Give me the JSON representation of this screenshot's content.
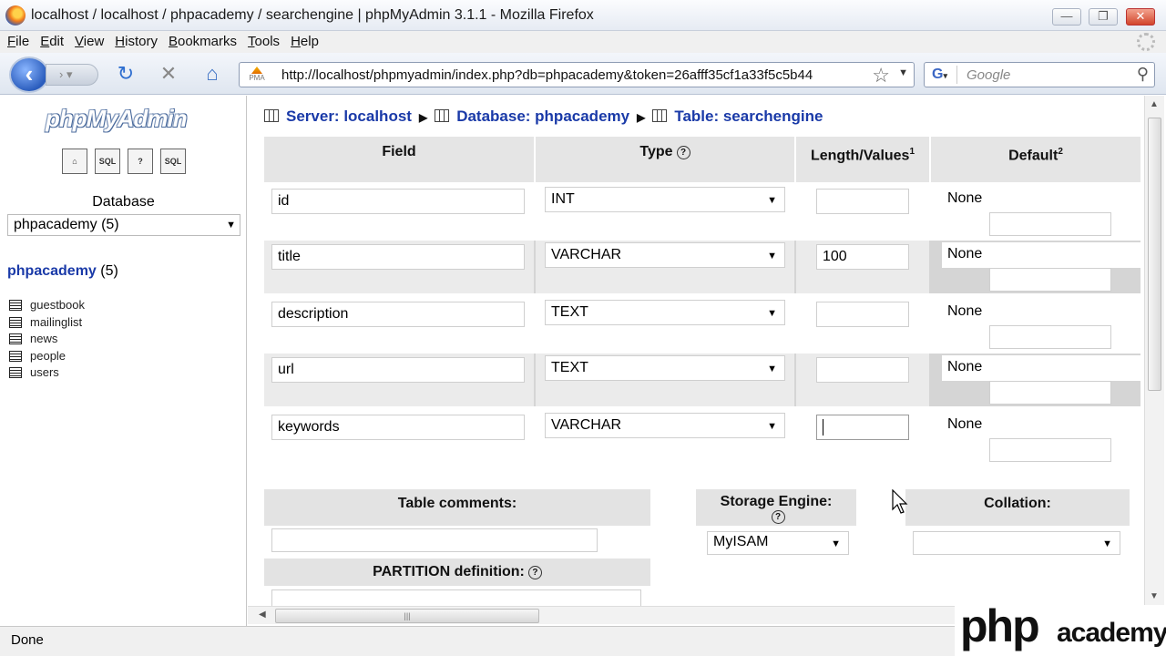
{
  "window": {
    "title": "localhost / localhost / phpacademy / searchengine | phpMyAdmin 3.1.1 - Mozilla Firefox",
    "controls": [
      "—",
      "❐",
      "✕"
    ]
  },
  "menu": [
    "File",
    "Edit",
    "View",
    "History",
    "Bookmarks",
    "Tools",
    "Help"
  ],
  "nav": {
    "url": "http://localhost/phpmyadmin/index.php?db=phpacademy&token=26afff35cf1a33f5c5b44",
    "search_placeholder": "Google",
    "favicon_label": "PMA"
  },
  "sidebar": {
    "logo": "phpMyAdmin",
    "icons": [
      "home-icon",
      "sql-icon",
      "help-icon",
      "query-icon"
    ],
    "icon_labels": [
      "⌂",
      "SQL",
      "?",
      "SQL"
    ],
    "database_label": "Database",
    "database_select": "phpacademy (5)",
    "db_name": "phpacademy",
    "db_count": "(5)",
    "tables": [
      "guestbook",
      "mailinglist",
      "news",
      "people",
      "users"
    ]
  },
  "breadcrumb": {
    "server": "Server: localhost",
    "database": "Database: phpacademy",
    "table": "Table: searchengine"
  },
  "columns": {
    "field": "Field",
    "type": "Type",
    "length": "Length/Values",
    "length_sup": "1",
    "default": "Default",
    "default_sup": "2"
  },
  "rows": [
    {
      "field": "id",
      "type": "INT",
      "length": "",
      "default": "None"
    },
    {
      "field": "title",
      "type": "VARCHAR",
      "length": "100",
      "default": "None"
    },
    {
      "field": "description",
      "type": "TEXT",
      "length": "",
      "default": "None"
    },
    {
      "field": "url",
      "type": "TEXT",
      "length": "",
      "default": "None"
    },
    {
      "field": "keywords",
      "type": "VARCHAR",
      "length": "",
      "default": "None"
    }
  ],
  "table_options": {
    "comments_label": "Table comments:",
    "storage_label": "Storage Engine:",
    "storage_value": "MyISAM",
    "collation_label": "Collation:",
    "collation_value": "",
    "partition_label": "PARTITION definition:"
  },
  "status": "Done",
  "watermark": {
    "php": "php",
    "academy": "academy"
  }
}
